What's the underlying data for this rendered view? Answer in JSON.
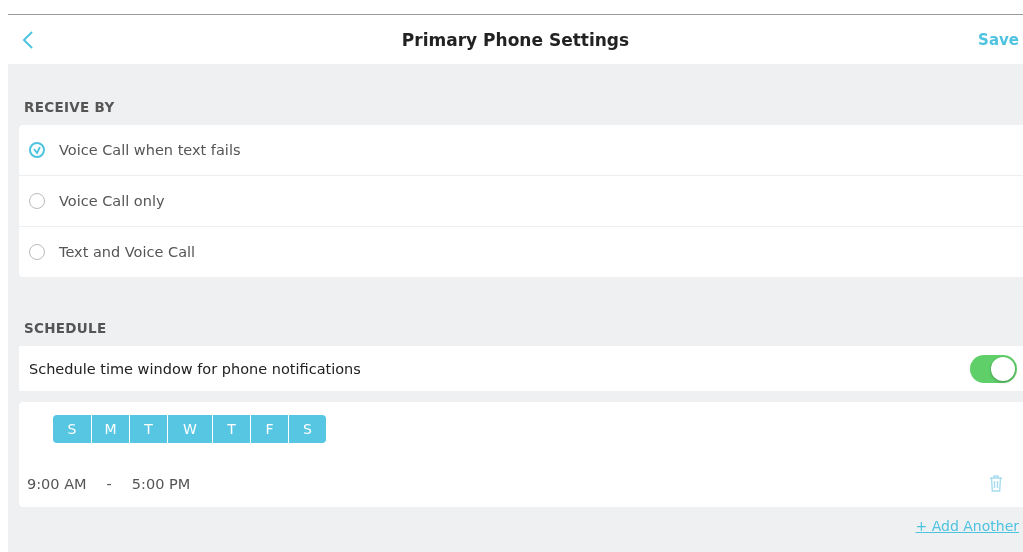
{
  "header": {
    "title": "Primary Phone Settings",
    "action": "Save"
  },
  "receive_by": {
    "label": "RECEIVE BY",
    "options": [
      {
        "label": "Voice Call when text fails",
        "selected": true
      },
      {
        "label": "Voice Call only",
        "selected": false
      },
      {
        "label": "Text and Voice Call",
        "selected": false
      }
    ]
  },
  "schedule": {
    "label": "SCHEDULE",
    "toggle": {
      "label": "Schedule time window for phone notifications",
      "on": true
    },
    "days": [
      {
        "label": "S",
        "selected": true
      },
      {
        "label": "M",
        "selected": true
      },
      {
        "label": "T",
        "selected": true
      },
      {
        "label": "W",
        "selected": true
      },
      {
        "label": "T",
        "selected": true
      },
      {
        "label": "F",
        "selected": true
      },
      {
        "label": "S",
        "selected": true
      }
    ],
    "start": "9:00 AM",
    "separator": "-",
    "end": "5:00 PM",
    "add_link": "+ Add Another"
  }
}
